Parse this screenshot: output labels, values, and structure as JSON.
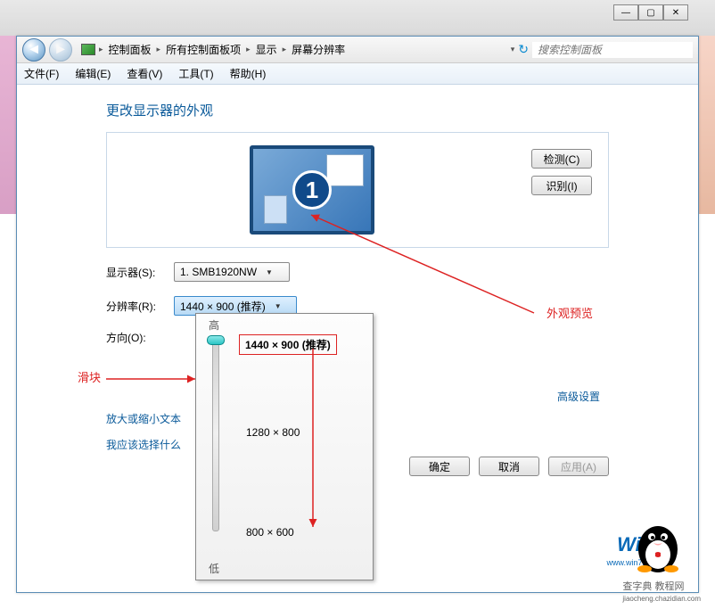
{
  "window_controls": {
    "min": "—",
    "max": "▢",
    "close": "✕"
  },
  "nav": {
    "back": "◄",
    "forward": "►"
  },
  "breadcrumb": {
    "items": [
      "控制面板",
      "所有控制面板项",
      "显示",
      "屏幕分辨率"
    ],
    "sep": "▸"
  },
  "refresh_icon": "↻",
  "search": {
    "placeholder": "搜索控制面板"
  },
  "menubar": {
    "file": "文件(F)",
    "edit": "编辑(E)",
    "view": "查看(V)",
    "tools": "工具(T)",
    "help": "帮助(H)"
  },
  "page_title": "更改显示器的外观",
  "preview": {
    "monitor_number": "1",
    "detect_btn": "检测(C)",
    "identify_btn": "识别(I)"
  },
  "form": {
    "display_label": "显示器(S):",
    "display_value": "1. SMB1920NW",
    "resolution_label": "分辨率(R):",
    "resolution_value": "1440 × 900 (推荐)",
    "orientation_label": "方向(O):"
  },
  "dropdown": {
    "high": "高",
    "low": "低",
    "selected": "1440 × 900 (推荐)",
    "mid": "1280 × 800",
    "lowres": "800 × 600"
  },
  "links": {
    "zoom_text": "放大或缩小文本",
    "which_choose": "我应该选择什么",
    "advanced": "高级设置"
  },
  "footer": {
    "ok": "确定",
    "cancel": "取消",
    "apply": "应用(A)"
  },
  "annotations": {
    "slider": "滑块",
    "preview": "外观预览"
  },
  "watermark": {
    "main": "WiN7.",
    "sub": "www.win7zhijia.cn",
    "site": "查字典 教程网",
    "site2": "jiaocheng.chazidian.com"
  }
}
